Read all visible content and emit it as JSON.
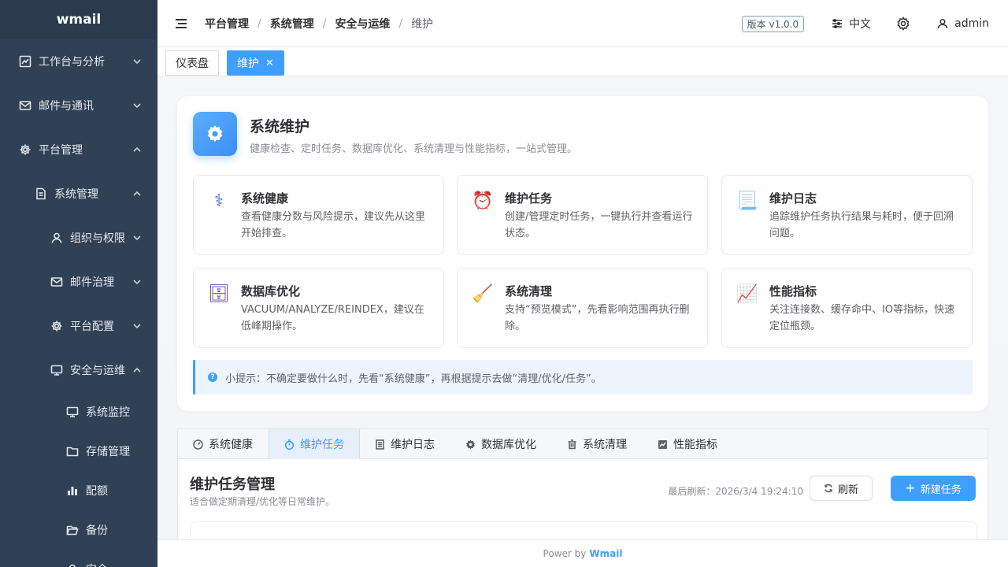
{
  "sidebar": {
    "logo": "wmail",
    "items": [
      {
        "label": "工作台与分析",
        "icon": "chart-line-icon"
      },
      {
        "label": "邮件与通讯",
        "icon": "mail-icon"
      },
      {
        "label": "平台管理",
        "icon": "gear-icon"
      },
      {
        "label": "系统管理",
        "icon": "document-icon"
      },
      {
        "label": "组织与权限",
        "icon": "user-icon"
      },
      {
        "label": "邮件治理",
        "icon": "mail-icon"
      },
      {
        "label": "平台配置",
        "icon": "gear-icon"
      },
      {
        "label": "安全与运维",
        "icon": "monitor-icon"
      },
      {
        "label": "系统监控",
        "icon": "monitor-icon"
      },
      {
        "label": "存储管理",
        "icon": "folder-icon"
      },
      {
        "label": "配额",
        "icon": "bar-chart-icon"
      },
      {
        "label": "备份",
        "icon": "folder-open-icon"
      },
      {
        "label": "安全",
        "icon": "user-icon"
      }
    ]
  },
  "header": {
    "breadcrumb": [
      "平台管理",
      "系统管理",
      "安全与运维",
      "维护"
    ],
    "version": "版本 v1.0.0",
    "language": "中文",
    "user": "admin"
  },
  "tags": [
    {
      "label": "仪表盘"
    },
    {
      "label": "维护",
      "close": "✕"
    }
  ],
  "hero": {
    "title": "系统维护",
    "subtitle": "健康检查、定时任务、数据库优化、系统清理与性能指标，一站式管理。"
  },
  "features": [
    {
      "title": "系统健康",
      "desc": "查看健康分数与风险提示，建议先从这里开始排查。",
      "icon": "stethoscope-icon",
      "glyph": "⚕"
    },
    {
      "title": "维护任务",
      "desc": "创建/管理定时任务，一键执行并查看运行状态。",
      "icon": "alarm-clock-icon",
      "glyph": "⏰"
    },
    {
      "title": "维护日志",
      "desc": "追踪维护任务执行结果与耗时，便于回溯问题。",
      "icon": "log-page-icon",
      "glyph": "📃"
    },
    {
      "title": "数据库优化",
      "desc": "VACUUM/ANALYZE/REINDEX，建议在低峰期操作。",
      "icon": "file-cabinet-icon",
      "glyph": "🗄"
    },
    {
      "title": "系统清理",
      "desc": "支持“预览模式”，先看影响范围再执行删除。",
      "icon": "broom-icon",
      "glyph": "🧹"
    },
    {
      "title": "性能指标",
      "desc": "关注连接数、缓存命中、IO等指标，快速定位瓶颈。",
      "icon": "chart-increasing-icon",
      "glyph": "📈"
    }
  ],
  "tip": {
    "icon_glyph": "?",
    "text": "小提示：不确定要做什么时，先看“系统健康”，再根据提示去做“清理/优化/任务”。"
  },
  "tabs": [
    {
      "label": "系统健康",
      "icon": "gauge-icon"
    },
    {
      "label": "维护任务",
      "icon": "timer-icon"
    },
    {
      "label": "维护日志",
      "icon": "list-icon"
    },
    {
      "label": "数据库优化",
      "icon": "gear-icon"
    },
    {
      "label": "系统清理",
      "icon": "trash-icon"
    },
    {
      "label": "性能指标",
      "icon": "chart-icon"
    }
  ],
  "panel": {
    "title": "维护任务管理",
    "subtitle": "适合做定期清理/优化等日常维护。",
    "last_refresh": "最后刷新：2026/3/4 19:24:10",
    "refresh_label": "刷新",
    "new_task_label": "新建任务",
    "new_task_plus": "+"
  },
  "footer": {
    "prefix": "Power by",
    "brand": "Wmail"
  },
  "colors": {
    "accent": "#409eff",
    "sidebar_bg": "#304156"
  }
}
